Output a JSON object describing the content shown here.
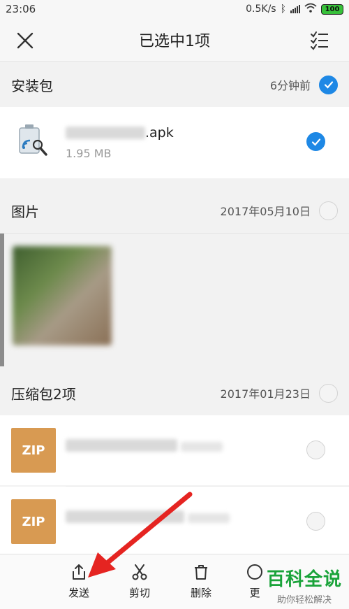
{
  "status_bar": {
    "time": "23:06",
    "network_speed": "0.5K/s",
    "battery": "100"
  },
  "header": {
    "title": "已选中1项"
  },
  "sections": {
    "apk": {
      "label": "安装包",
      "meta": "6分钟前",
      "selected": true
    },
    "images": {
      "label": "图片",
      "meta": "2017年05月10日",
      "selected": false
    },
    "archives": {
      "label": "压缩包2项",
      "meta": "2017年01月23日",
      "selected": false
    }
  },
  "apk_file": {
    "name_suffix": ".apk",
    "size": "1.95 MB",
    "selected": true
  },
  "zip_files": [
    {
      "icon_label": "ZIP",
      "selected": false
    },
    {
      "icon_label": "ZIP",
      "selected": false
    }
  ],
  "toolbar": {
    "send": "发送",
    "cut": "剪切",
    "delete": "删除",
    "more": "更"
  },
  "watermark": {
    "line1": "百科全说",
    "line2": "助你轻松解决"
  },
  "colors": {
    "accent": "#1e88e5",
    "zip": "#d89a52",
    "arrow": "#e52421",
    "watermark": "#1aa33a"
  }
}
